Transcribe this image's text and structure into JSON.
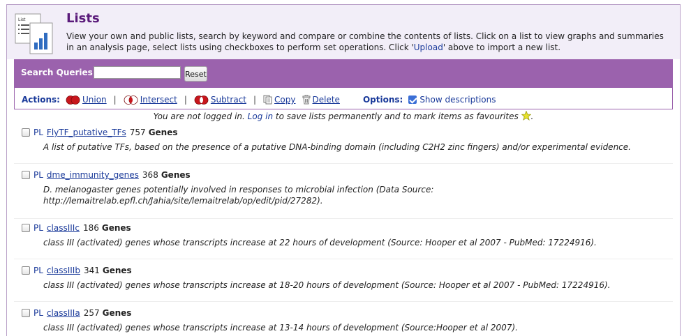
{
  "header": {
    "title": "Lists",
    "desc_part1": "View your own and public lists, search by keyword and compare or combine the contents of lists. Click on a list to view graphs and summaries in an analysis page, select lists using checkboxes to perform set operations. Click '",
    "upload_link": "Upload",
    "desc_part2": "' above to import a new list."
  },
  "search": {
    "label": "Search Queries:",
    "value": "",
    "reset_label": "Reset"
  },
  "actions": {
    "label": "Actions:",
    "union": "Union",
    "intersect": "Intersect",
    "subtract": "Subtract",
    "copy": "Copy",
    "delete": "Delete",
    "options_label": "Options:",
    "show_descriptions": "Show descriptions",
    "show_descriptions_checked": true
  },
  "notice": {
    "part1": "You are not logged in. ",
    "login_link": "Log in",
    "part2": " to save lists permanently and to mark items as favourites"
  },
  "lists": [
    {
      "prefix": "PL",
      "name": "FlyTF_putative_TFs",
      "count": "757",
      "type": "Genes",
      "description": "A list of putative TFs, based on the presence of a putative DNA-binding domain (including C2H2 zinc fingers) and/or experimental evidence."
    },
    {
      "prefix": "PL",
      "name": "dme_immunity_genes",
      "count": "368",
      "type": "Genes",
      "description": "D. melanogaster genes potentially involved in responses to microbial infection (Data Source: http://lemaitrelab.epfl.ch/Jahia/site/lemaitrelab/op/edit/pid/27282)."
    },
    {
      "prefix": "PL",
      "name": "classIIIc",
      "count": "186",
      "type": "Genes",
      "description": "class III (activated) genes whose transcripts increase at 22 hours of development (Source: Hooper et al 2007 - PubMed: 17224916)."
    },
    {
      "prefix": "PL",
      "name": "classIIIb",
      "count": "341",
      "type": "Genes",
      "description": "class III (activated) genes whose transcripts increase at 18-20 hours of development (Source: Hooper et al 2007 - PubMed: 17224916)."
    },
    {
      "prefix": "PL",
      "name": "classIIIa",
      "count": "257",
      "type": "Genes",
      "description": "class III (activated) genes whose transcripts increase at 13-14 hours of development (Source:Hooper et al 2007)."
    }
  ],
  "colors": {
    "accent": "#9b62ad",
    "title": "#5a1a7a",
    "link": "#1a3a9a",
    "header_bg": "#f2eef8"
  },
  "icons": {
    "header": "lists-document-chart-icon",
    "union": "venn-union-icon",
    "intersect": "venn-intersect-icon",
    "subtract": "venn-subtract-icon",
    "copy": "copy-icon",
    "delete": "trash-icon",
    "favourite": "star-icon"
  }
}
